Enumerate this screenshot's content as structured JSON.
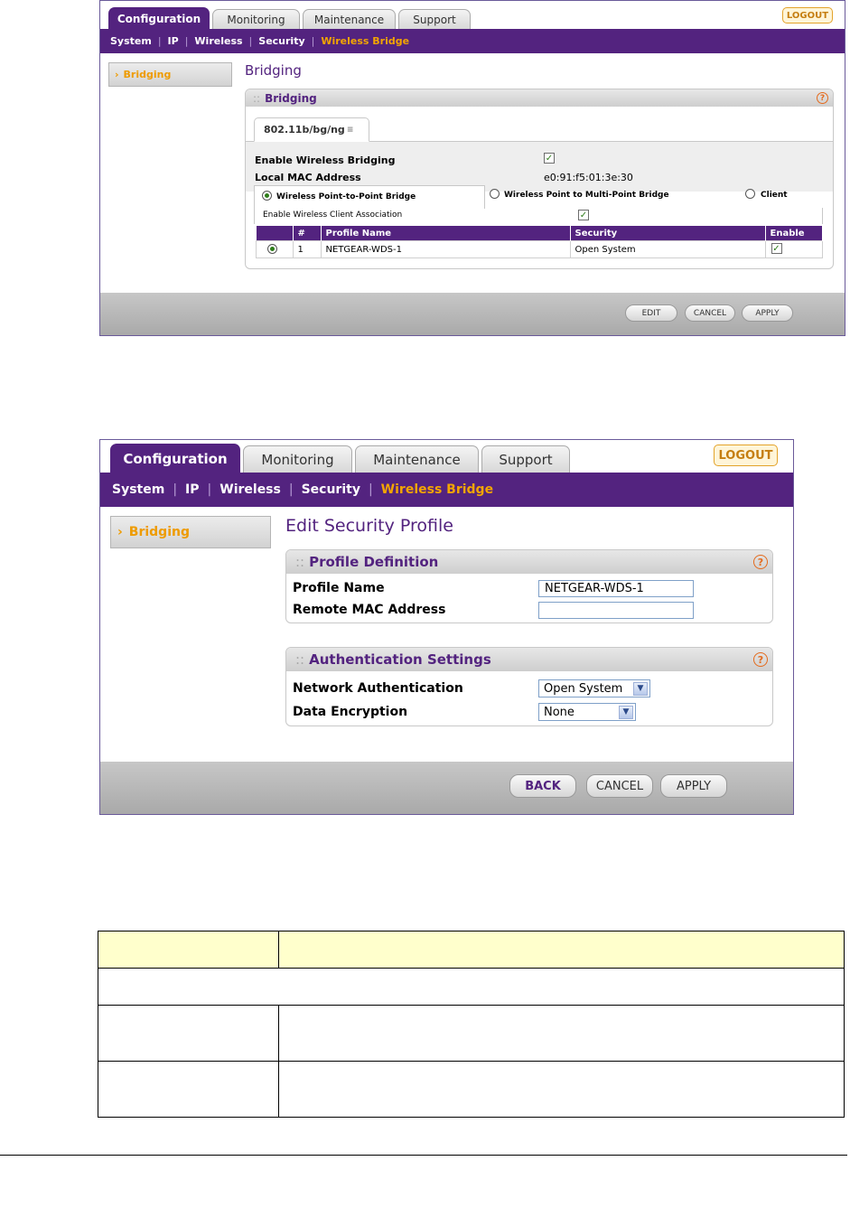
{
  "tabs": [
    "Configuration",
    "Monitoring",
    "Maintenance",
    "Support"
  ],
  "logout": "LOGOUT",
  "subnav": [
    "System",
    "IP",
    "Wireless",
    "Security",
    "Wireless Bridge"
  ],
  "sidebar_item": "Bridging",
  "screen1": {
    "page_title": "Bridging",
    "panel_title": "Bridging",
    "mode_tab": "802.11b/bg/ng",
    "enable_bridging_label": "Enable Wireless Bridging",
    "enable_bridging_checked": true,
    "mac_label": "Local MAC Address",
    "mac_value": "e0:91:f5:01:3e:30",
    "modes": [
      "Wireless Point-to-Point Bridge",
      "Wireless Point to Multi-Point Bridge",
      "Client"
    ],
    "selected_mode": "Wireless Point-to-Point Bridge",
    "client_assoc_label": "Enable Wireless Client Association",
    "client_assoc_checked": true,
    "table_headers": [
      "",
      "#",
      "Profile Name",
      "Security",
      "Enable"
    ],
    "rows": [
      {
        "num": "1",
        "profile": "NETGEAR-WDS-1",
        "security": "Open System",
        "enabled": true
      }
    ],
    "buttons": [
      "EDIT",
      "CANCEL",
      "APPLY"
    ]
  },
  "screen2": {
    "page_title": "Edit Security Profile",
    "profile_section": "Profile Definition",
    "profile_name_label": "Profile Name",
    "profile_name_value": "NETGEAR-WDS-1",
    "remote_mac_label": "Remote MAC Address",
    "remote_mac_value": "",
    "auth_section": "Authentication Settings",
    "network_auth_label": "Network Authentication",
    "network_auth_value": "Open System",
    "data_encryption_label": "Data Encryption",
    "data_encryption_value": "None",
    "buttons": [
      "BACK",
      "CANCEL",
      "APPLY"
    ]
  },
  "help_glyph": "?",
  "colors": {
    "brand_purple": "#53237f",
    "accent_orange": "#ee9b00",
    "doc_header_yellow": "#ffffcc"
  }
}
